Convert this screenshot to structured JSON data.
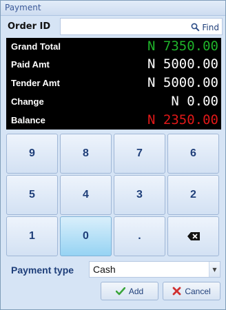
{
  "window": {
    "title": "Payment"
  },
  "order": {
    "label": "Order ID",
    "value": "",
    "find_label": "Find"
  },
  "summary": [
    {
      "label": "Grand Total",
      "value": "N 7350.00",
      "color": "#1fb32a"
    },
    {
      "label": "Paid Amt",
      "value": "N 5000.00",
      "color": "#ffffff"
    },
    {
      "label": "Tender Amt",
      "value": "N 5000.00",
      "color": "#ffffff"
    },
    {
      "label": "Change",
      "value": "N 0.00",
      "color": "#ffffff"
    },
    {
      "label": "Balance",
      "value": "N 2350.00",
      "color": "#e01818"
    }
  ],
  "keypad": {
    "keys": [
      "9",
      "8",
      "7",
      "6",
      "5",
      "4",
      "3",
      "2",
      "1",
      "0",
      ".",
      ""
    ],
    "backspace_icon": "backspace-icon",
    "active_key": "0"
  },
  "payment": {
    "label": "Payment type",
    "selected": "Cash"
  },
  "buttons": {
    "add_label": "Add",
    "cancel_label": "Cancel"
  },
  "colors": {
    "accent": "#1f3f7a",
    "add_check": "#3aa53a",
    "cancel_x": "#d03030"
  }
}
